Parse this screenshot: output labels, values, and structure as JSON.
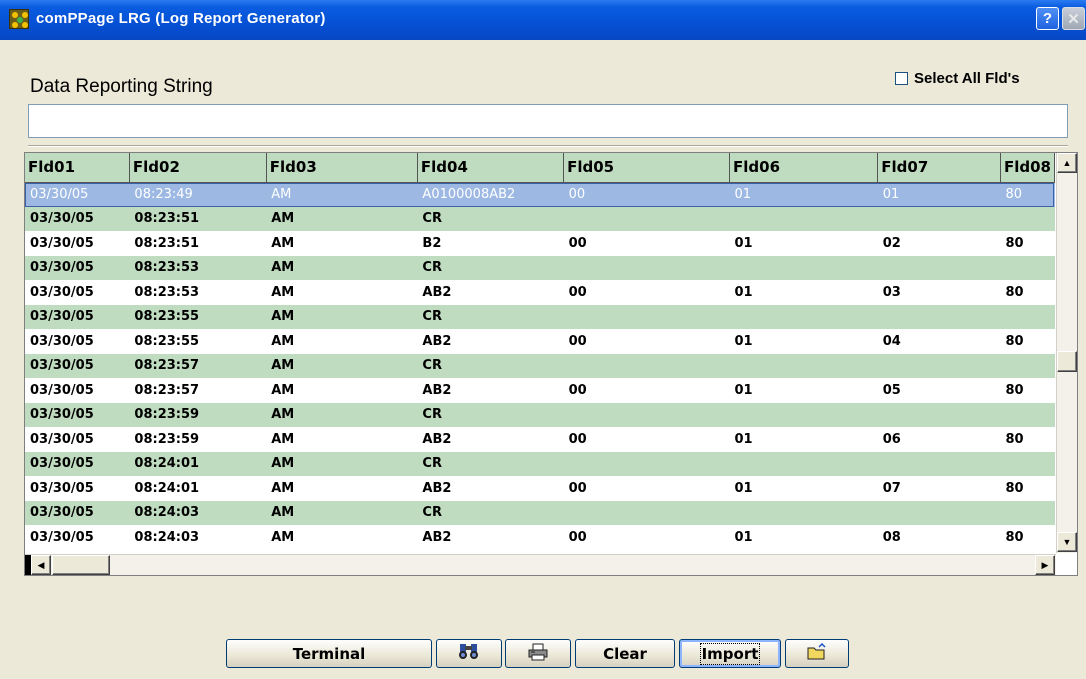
{
  "window": {
    "title": "comPPage LRG (Log Report Generator)",
    "help_label": "?",
    "close_label": "✕"
  },
  "header": {
    "section_title": "Data Reporting String",
    "select_all_label": "Select All Fld's",
    "reporting_string_value": ""
  },
  "grid": {
    "columns": [
      "Fld01",
      "Fld02",
      "Fld03",
      "Fld04",
      "Fld05",
      "Fld06",
      "Fld07",
      "Fld08"
    ],
    "selected_row": 0,
    "rows": [
      [
        "03/30/05",
        "08:23:49",
        "AM",
        "A0100008AB2",
        "00",
        "01",
        "01",
        "80"
      ],
      [
        "03/30/05",
        "08:23:51",
        "AM",
        "CR",
        "",
        "",
        "",
        ""
      ],
      [
        "03/30/05",
        "08:23:51",
        "AM",
        "B2",
        "00",
        "01",
        "02",
        "80"
      ],
      [
        "03/30/05",
        "08:23:53",
        "AM",
        "CR",
        "",
        "",
        "",
        ""
      ],
      [
        "03/30/05",
        "08:23:53",
        "AM",
        "AB2",
        "00",
        "01",
        "03",
        "80"
      ],
      [
        "03/30/05",
        "08:23:55",
        "AM",
        "CR",
        "",
        "",
        "",
        ""
      ],
      [
        "03/30/05",
        "08:23:55",
        "AM",
        "AB2",
        "00",
        "01",
        "04",
        "80"
      ],
      [
        "03/30/05",
        "08:23:57",
        "AM",
        "CR",
        "",
        "",
        "",
        ""
      ],
      [
        "03/30/05",
        "08:23:57",
        "AM",
        "AB2",
        "00",
        "01",
        "05",
        "80"
      ],
      [
        "03/30/05",
        "08:23:59",
        "AM",
        "CR",
        "",
        "",
        "",
        ""
      ],
      [
        "03/30/05",
        "08:23:59",
        "AM",
        "AB2",
        "00",
        "01",
        "06",
        "80"
      ],
      [
        "03/30/05",
        "08:24:01",
        "AM",
        "CR",
        "",
        "",
        "",
        ""
      ],
      [
        "03/30/05",
        "08:24:01",
        "AM",
        "AB2",
        "00",
        "01",
        "07",
        "80"
      ],
      [
        "03/30/05",
        "08:24:03",
        "AM",
        "CR",
        "",
        "",
        "",
        ""
      ],
      [
        "03/30/05",
        "08:24:03",
        "AM",
        "AB2",
        "00",
        "01",
        "08",
        "80"
      ]
    ]
  },
  "toolbar": {
    "terminal_label": "Terminal",
    "find_icon": "binoculars-icon",
    "print_icon": "printer-icon",
    "clear_label": "Clear",
    "import_label": "Import",
    "open_icon": "open-folder-icon"
  },
  "colors": {
    "titlebar": "#0550d4",
    "row_alt": "#c0dcc0",
    "row_selected": "#9db9e3",
    "window_bg": "#ece9d8"
  }
}
